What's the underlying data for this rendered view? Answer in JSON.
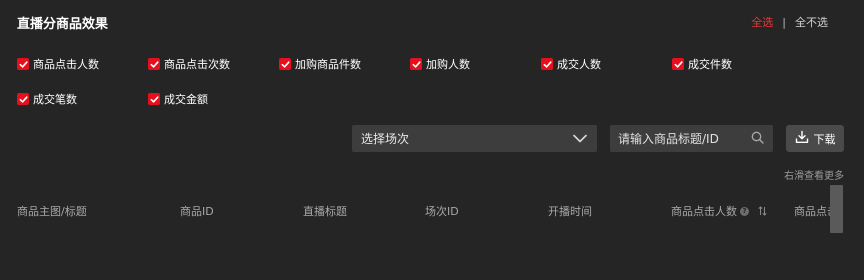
{
  "title": "直播分商品效果",
  "select_all": "全选",
  "separator": "|",
  "select_none": "全不选",
  "metrics": [
    {
      "label": "商品点击人数",
      "checked": true
    },
    {
      "label": "商品点击次数",
      "checked": true
    },
    {
      "label": "加购商品件数",
      "checked": true
    },
    {
      "label": "加购人数",
      "checked": true
    },
    {
      "label": "成交人数",
      "checked": true
    },
    {
      "label": "成交件数",
      "checked": true
    },
    {
      "label": "成交笔数",
      "checked": true
    },
    {
      "label": "成交金额",
      "checked": true
    }
  ],
  "session_select": {
    "value": "选择场次",
    "icon": "chevron-down-icon"
  },
  "search": {
    "placeholder": "请输入商品标题/ID",
    "value": "",
    "icon": "search-icon"
  },
  "download_label": "下载",
  "scroll_hint": "右滑查看更多",
  "table": {
    "columns": [
      "商品主图/标题",
      "商品ID",
      "直播标题",
      "场次ID",
      "开播时间",
      "商品点击人数",
      "商品点击"
    ]
  },
  "colors": {
    "accent": "#e5101d",
    "link_active": "#e23a3a",
    "background": "#252525"
  }
}
